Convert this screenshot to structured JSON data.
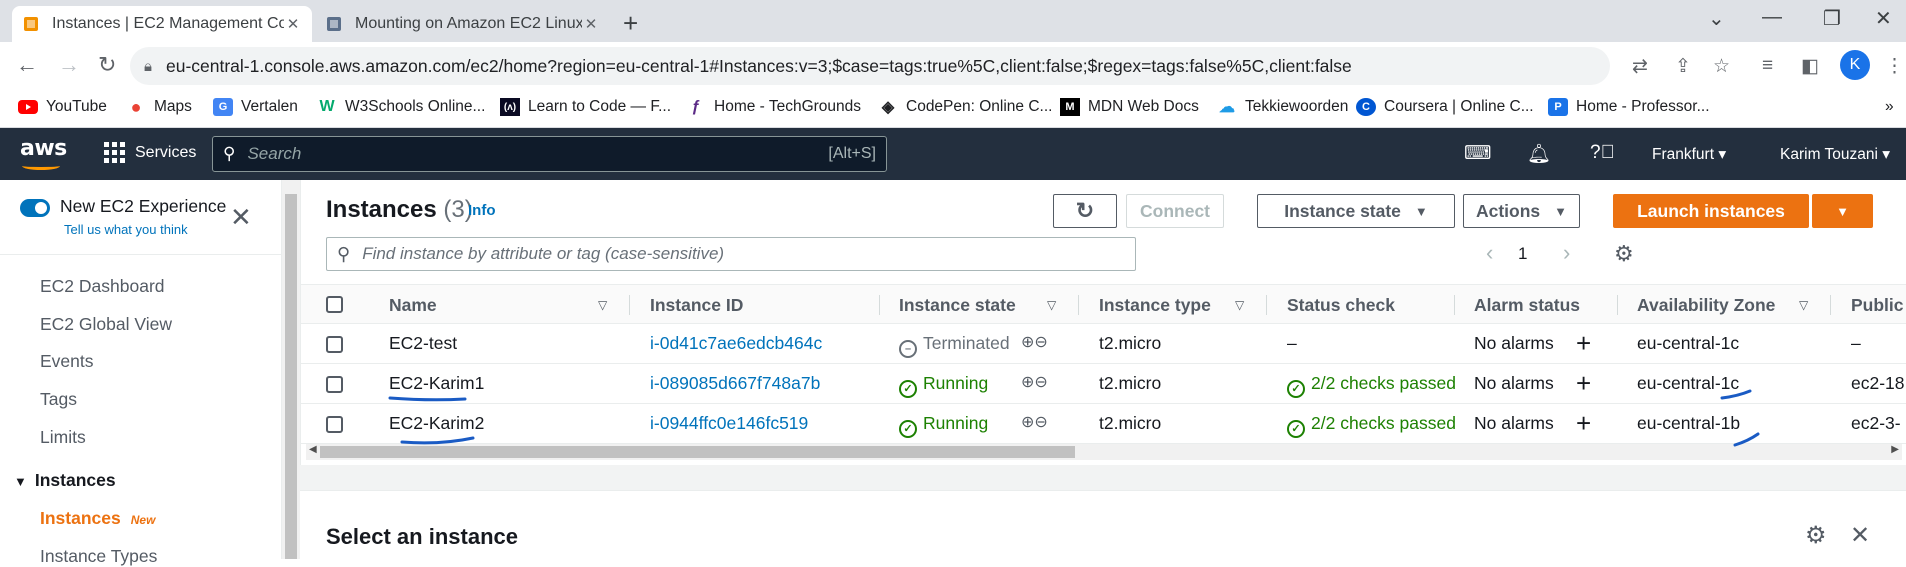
{
  "browser": {
    "tabs": [
      {
        "title": "Instances | EC2 Management Con",
        "active": true
      },
      {
        "title": "Mounting on Amazon EC2 Linux",
        "active": false
      }
    ],
    "new_tab": "+",
    "url": "eu-central-1.console.aws.amazon.com/ec2/home?region=eu-central-1#Instances:v=3;$case=tags:true%5C,client:false;$regex=tags:false%5C,client:false",
    "profile_initial": "K",
    "bookmarks": [
      {
        "label": "YouTube",
        "icon": "youtube-icon"
      },
      {
        "label": "Maps",
        "icon": "maps-icon"
      },
      {
        "label": "Vertalen",
        "icon": "translate-icon"
      },
      {
        "label": "W3Schools Online...",
        "icon": "w3schools-icon"
      },
      {
        "label": "Learn to Code — F...",
        "icon": "freecodecamp-icon"
      },
      {
        "label": "Home - TechGrounds",
        "icon": "techgrounds-icon"
      },
      {
        "label": "CodePen: Online C...",
        "icon": "codepen-icon"
      },
      {
        "label": "MDN Web Docs",
        "icon": "mdn-icon"
      },
      {
        "label": "Tekkiewoorden",
        "icon": "tekkiewoorden-icon"
      },
      {
        "label": "Coursera | Online C...",
        "icon": "coursera-icon"
      },
      {
        "label": "Home - Professor...",
        "icon": "professor-icon"
      }
    ]
  },
  "aws": {
    "logo": "aws",
    "services_label": "Services",
    "search_placeholder": "Search",
    "search_shortcut": "[Alt+S]",
    "region": "Frankfurt",
    "user": "Karim Touzani"
  },
  "sidebar": {
    "new_experience": "New EC2 Experience",
    "tell_us": "Tell us what you think",
    "items": [
      "EC2 Dashboard",
      "EC2 Global View",
      "Events",
      "Tags",
      "Limits"
    ],
    "section": "Instances",
    "active_item": "Instances",
    "active_badge": "New",
    "next_item": "Instance Types"
  },
  "main": {
    "title": "Instances",
    "count": "(3)",
    "info": "Info",
    "buttons": {
      "connect": "Connect",
      "instance_state": "Instance state",
      "actions": "Actions",
      "launch": "Launch instances"
    },
    "search_placeholder": "Find instance by attribute or tag (case-sensitive)",
    "page": "1",
    "columns": [
      "Name",
      "Instance ID",
      "Instance state",
      "Instance type",
      "Status check",
      "Alarm status",
      "Availability Zone",
      "Public"
    ],
    "rows": [
      {
        "name": "EC2-test",
        "id": "i-0d41c7ae6edcb464c",
        "state": "Terminated",
        "state_kind": "terminated",
        "type": "t2.micro",
        "status": "–",
        "alarm": "No alarms",
        "az": "eu-central-1c",
        "public": "–"
      },
      {
        "name": "EC2-Karim1",
        "id": "i-089085d667f748a7b",
        "state": "Running",
        "state_kind": "running",
        "type": "t2.micro",
        "status": "2/2 checks passed",
        "alarm": "No alarms",
        "az": "eu-central-1c",
        "public": "ec2-18"
      },
      {
        "name": "EC2-Karim2",
        "id": "i-0944ffc0e146fc519",
        "state": "Running",
        "state_kind": "running",
        "type": "t2.micro",
        "status": "2/2 checks passed",
        "alarm": "No alarms",
        "az": "eu-central-1b",
        "public": "ec2-3-"
      }
    ],
    "detail_title": "Select an instance"
  },
  "colors": {
    "aws_nav": "#232f3e",
    "accent_orange": "#ec7211",
    "link_blue": "#0073bb",
    "success_green": "#1d8102",
    "annotation_ink": "#1a5bc4"
  }
}
